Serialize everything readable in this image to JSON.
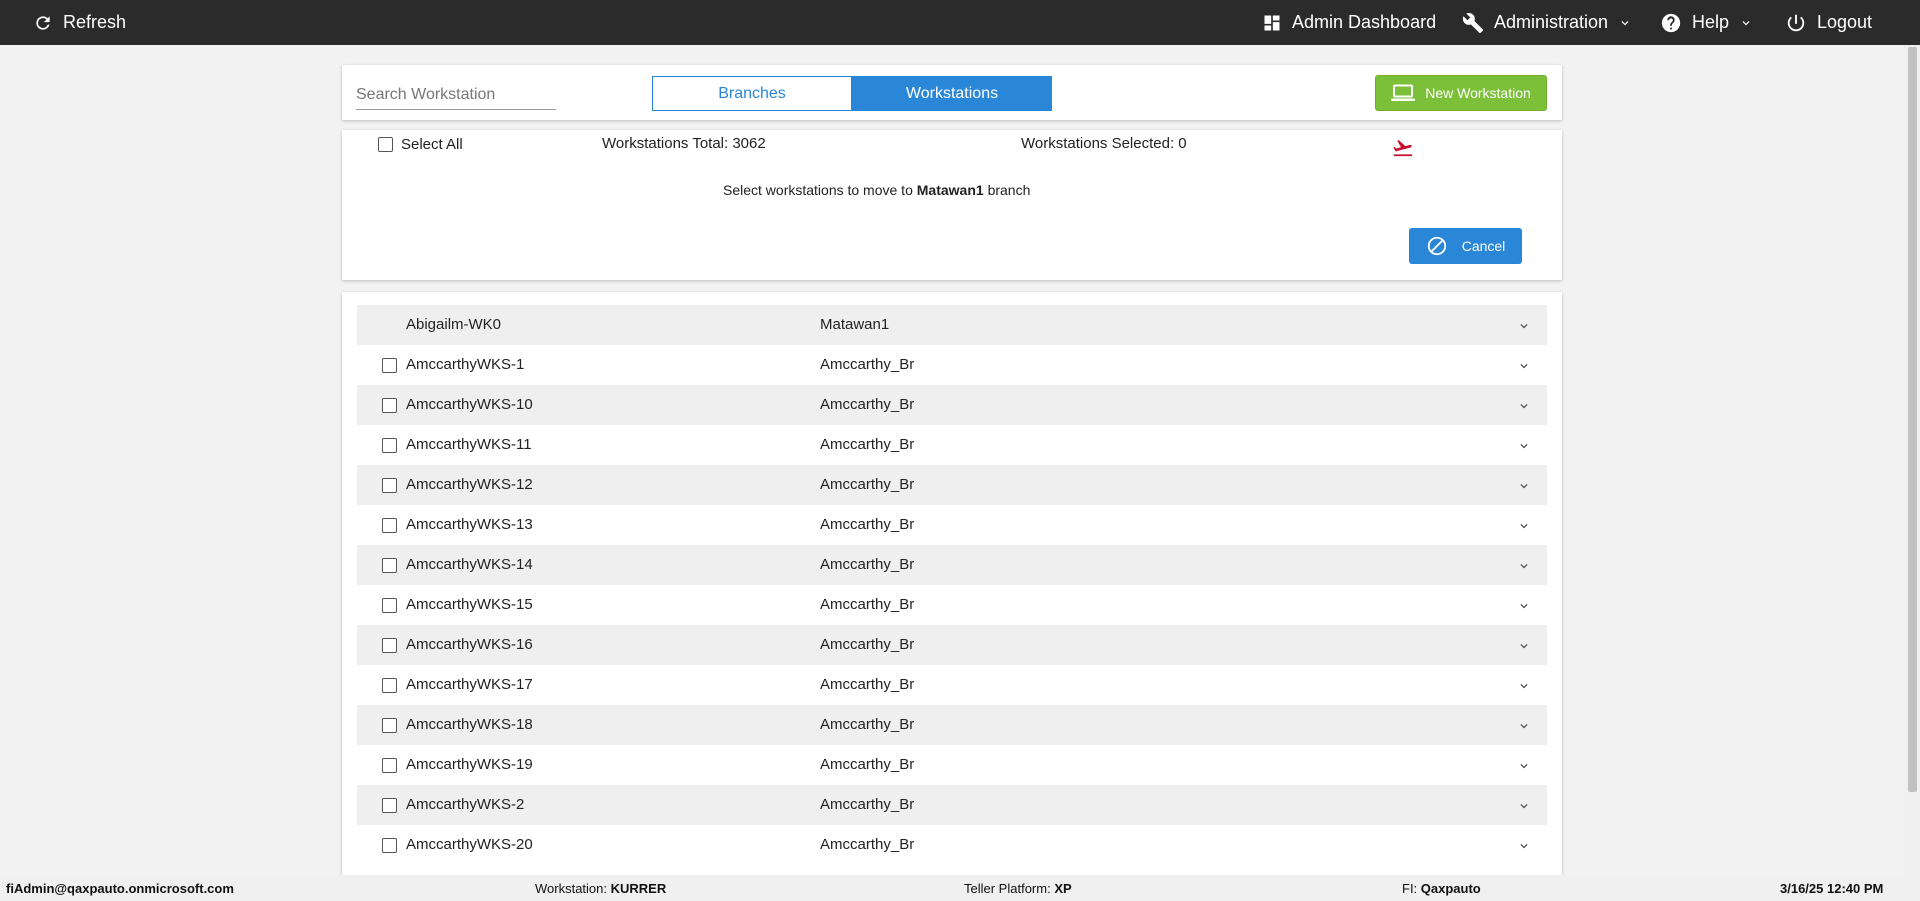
{
  "header": {
    "refresh_label": "Refresh",
    "admin_dashboard_label": "Admin Dashboard",
    "administration_label": "Administration",
    "help_label": "Help",
    "logout_label": "Logout"
  },
  "toolbar": {
    "search_placeholder": "Search Workstation",
    "tab_branches": "Branches",
    "tab_workstations": "Workstations",
    "active_tab": "Workstations",
    "new_workstation_label": "New Workstation"
  },
  "selection": {
    "select_all_label": "Select All",
    "total_label": "Workstations Total: 3062",
    "selected_label": "Workstations Selected: 0",
    "move_text_prefix": "Select workstations to move to ",
    "move_target": "Matawan1",
    "move_text_suffix": " branch",
    "cancel_label": "Cancel"
  },
  "workstations": [
    {
      "name": "Abigailm-WK0",
      "branch": "Matawan1",
      "selectable": false
    },
    {
      "name": "AmccarthyWKS-1",
      "branch": "Amccarthy_Br",
      "selectable": true
    },
    {
      "name": "AmccarthyWKS-10",
      "branch": "Amccarthy_Br",
      "selectable": true
    },
    {
      "name": "AmccarthyWKS-11",
      "branch": "Amccarthy_Br",
      "selectable": true
    },
    {
      "name": "AmccarthyWKS-12",
      "branch": "Amccarthy_Br",
      "selectable": true
    },
    {
      "name": "AmccarthyWKS-13",
      "branch": "Amccarthy_Br",
      "selectable": true
    },
    {
      "name": "AmccarthyWKS-14",
      "branch": "Amccarthy_Br",
      "selectable": true
    },
    {
      "name": "AmccarthyWKS-15",
      "branch": "Amccarthy_Br",
      "selectable": true
    },
    {
      "name": "AmccarthyWKS-16",
      "branch": "Amccarthy_Br",
      "selectable": true
    },
    {
      "name": "AmccarthyWKS-17",
      "branch": "Amccarthy_Br",
      "selectable": true
    },
    {
      "name": "AmccarthyWKS-18",
      "branch": "Amccarthy_Br",
      "selectable": true
    },
    {
      "name": "AmccarthyWKS-19",
      "branch": "Amccarthy_Br",
      "selectable": true
    },
    {
      "name": "AmccarthyWKS-2",
      "branch": "Amccarthy_Br",
      "selectable": true
    },
    {
      "name": "AmccarthyWKS-20",
      "branch": "Amccarthy_Br",
      "selectable": true
    }
  ],
  "status": {
    "user": "fiAdmin@qaxpauto.onmicrosoft.com",
    "workstation_label": "Workstation: ",
    "workstation_value": "KURRER",
    "platform_label": "Teller Platform: ",
    "platform_value": "XP",
    "fi_label": "FI: ",
    "fi_value": "Qaxpauto",
    "datetime": "3/16/25 12:40 PM"
  },
  "colors": {
    "topbar": "#2b2b2b",
    "accent_blue": "#2a86d6",
    "new_button_green": "#7cc03a",
    "move_icon_red": "#c8102e"
  }
}
